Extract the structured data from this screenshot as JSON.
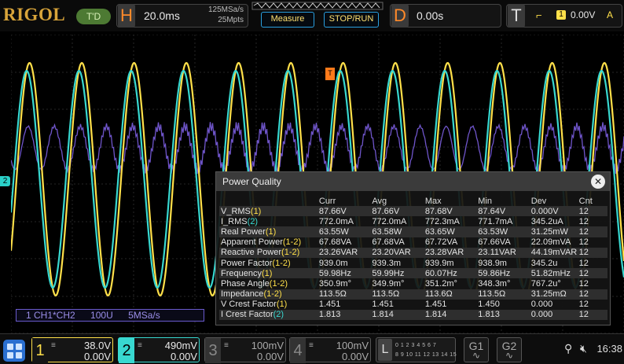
{
  "header": {
    "logo": "RIGOL",
    "trigger_state": "T'D",
    "h_letter": "H",
    "timebase": "20.0ms",
    "sample_rate": "125MSa/s",
    "memory_depth": "25Mpts",
    "measure_button": "Measure",
    "stoprun_button": "STOP/RUN",
    "d_letter": "D",
    "delay": "0.00s",
    "t_letter": "T",
    "trigger_source": "1",
    "trigger_level": "0.00V",
    "trigger_mode": "A"
  },
  "plot": {
    "ch2_marker": "2",
    "trigger_marker": "T",
    "math_label": {
      "expr": "1 CH1*CH2",
      "scale": "100U",
      "rate": "5MSa/s"
    }
  },
  "power_quality": {
    "title": "Power Quality",
    "columns": [
      "",
      "Curr",
      "Avg",
      "Max",
      "Min",
      "Dev",
      "Cnt"
    ],
    "rows": [
      {
        "name": "V_RMS",
        "src": "(1)",
        "src_color": "c1",
        "values": [
          "87.66V",
          "87.66V",
          "87.68V",
          "87.64V",
          "0.000V",
          "12"
        ]
      },
      {
        "name": "I_RMS",
        "src": "(2)",
        "src_color": "c2",
        "values": [
          "772.0mA",
          "772.0mA",
          "772.3mA",
          "771.7mA",
          "345.2uA",
          "12"
        ]
      },
      {
        "name": "Real Power",
        "src": "(1)",
        "src_color": "c1",
        "values": [
          "63.55W",
          "63.58W",
          "63.65W",
          "63.53W",
          "31.25mW",
          "12"
        ]
      },
      {
        "name": "Apparent Power",
        "src": "(1-2)",
        "src_color": "c1",
        "values": [
          "67.68VA",
          "67.68VA",
          "67.72VA",
          "67.66VA",
          "22.09mVA",
          "12"
        ]
      },
      {
        "name": "Reactive Power",
        "src": "(1-2)",
        "src_color": "c1",
        "values": [
          "23.26VAR",
          "23.20VAR",
          "23.28VAR",
          "23.11VAR",
          "44.19mVAR",
          "12"
        ]
      },
      {
        "name": "Power Factor",
        "src": "(1-2)",
        "src_color": "c1",
        "values": [
          "939.0m",
          "939.3m",
          "939.9m",
          "938.9m",
          "345.2u",
          "12"
        ]
      },
      {
        "name": "Frequency",
        "src": "(1)",
        "src_color": "c1",
        "values": [
          "59.98Hz",
          "59.99Hz",
          "60.07Hz",
          "59.86Hz",
          "51.82mHz",
          "12"
        ]
      },
      {
        "name": "Phase Angle",
        "src": "(1-2)",
        "src_color": "c1",
        "values": [
          "350.9m°",
          "349.9m°",
          "351.2m°",
          "348.3m°",
          "767.2u°",
          "12"
        ]
      },
      {
        "name": "Impedance",
        "src": "(1-2)",
        "src_color": "c1",
        "values": [
          "113.5Ω",
          "113.5Ω",
          "113.6Ω",
          "113.5Ω",
          "31.25mΩ",
          "12"
        ]
      },
      {
        "name": "V Crest Factor",
        "src": "(1)",
        "src_color": "c1",
        "values": [
          "1.451",
          "1.451",
          "1.451",
          "1.450",
          "0.000",
          "12"
        ]
      },
      {
        "name": "I Crest Factor",
        "src": "(2)",
        "src_color": "c2",
        "values": [
          "1.813",
          "1.814",
          "1.814",
          "1.813",
          "0.000",
          "12"
        ]
      }
    ]
  },
  "channels": [
    {
      "num": "1",
      "scale": "38.0V",
      "offset": "0.00V",
      "color": "#ffe04a"
    },
    {
      "num": "2",
      "scale": "490mV",
      "offset": "0.00V",
      "color": "#38d8d0"
    },
    {
      "num": "3",
      "scale": "100mV",
      "offset": "0.00V",
      "color": "#888888"
    },
    {
      "num": "4",
      "scale": "100mV",
      "offset": "0.00V",
      "color": "#888888"
    }
  ],
  "footer": {
    "l_letter": "L",
    "l_row1": "0 1 2 3 4 5 6 7",
    "l_row2": "8 9 10 11 12 13 14 15",
    "g1": "G1",
    "g2": "G2",
    "clock": "16:38"
  },
  "colors": {
    "ch1": "#ffe04a",
    "ch2": "#38d8d0",
    "math": "#7b5ee0",
    "accent": "#ff8a2a"
  }
}
